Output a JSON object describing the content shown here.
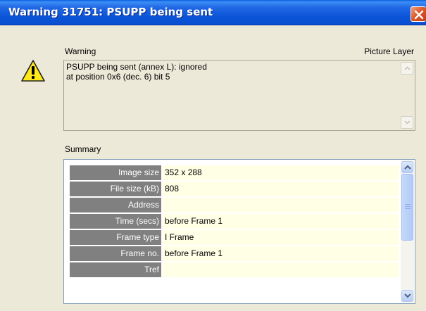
{
  "window": {
    "title": "Warning 31751: PSUPP being sent"
  },
  "warning": {
    "label": "Warning",
    "category": "Picture Layer",
    "text": "PSUPP being sent (annex L): ignored\nat position 0x6 (dec. 6) bit 5"
  },
  "summary": {
    "label": "Summary",
    "rows": [
      {
        "label": "Image size",
        "value": "352 x 288"
      },
      {
        "label": "File size (kB)",
        "value": "808"
      },
      {
        "label": "Address",
        "value": ""
      },
      {
        "label": "Time (secs)",
        "value": "before Frame 1"
      },
      {
        "label": "Frame type",
        "value": "I Frame"
      },
      {
        "label": "Frame no.",
        "value": "before Frame 1"
      },
      {
        "label": "Tref",
        "value": ""
      }
    ]
  },
  "icons": {
    "warning": "warning-triangle-icon",
    "close": "close-icon"
  },
  "colors": {
    "titlebar": "#0b54d8",
    "label_cell": "#808080",
    "value_cell": "#ffffe6",
    "close_button": "#e05a2a"
  }
}
